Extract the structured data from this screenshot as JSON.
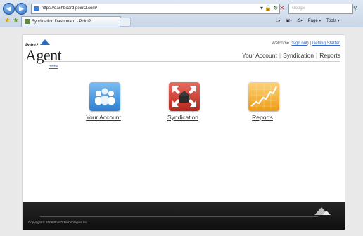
{
  "browser": {
    "url": "https://dashboard.point2.com/",
    "search_placeholder": "Google",
    "tab_title": "Syndication Dashboard - Point2",
    "command_bar": [
      "Page ▾",
      "Tools ▾"
    ]
  },
  "header": {
    "logo_small": "Point2",
    "logo_main": "Agent",
    "home_link": "Home",
    "welcome_prefix": "Welcome (",
    "sign_out": "Sign out",
    "welcome_suffix": ")  |",
    "getting_started": "Getting Started",
    "nav": [
      "Your Account",
      "Syndication",
      "Reports"
    ]
  },
  "tiles": [
    {
      "label": "Your Account",
      "icon": "users-icon",
      "color": "#3d8fd6"
    },
    {
      "label": "Syndication",
      "icon": "syndication-arrows-icon",
      "color": "#d43a2f"
    },
    {
      "label": "Reports",
      "icon": "chart-growth-icon",
      "color": "#f3a51e"
    }
  ],
  "footer": {
    "copyright": "Copyright © 2008 Point2 Technologies Inc."
  }
}
